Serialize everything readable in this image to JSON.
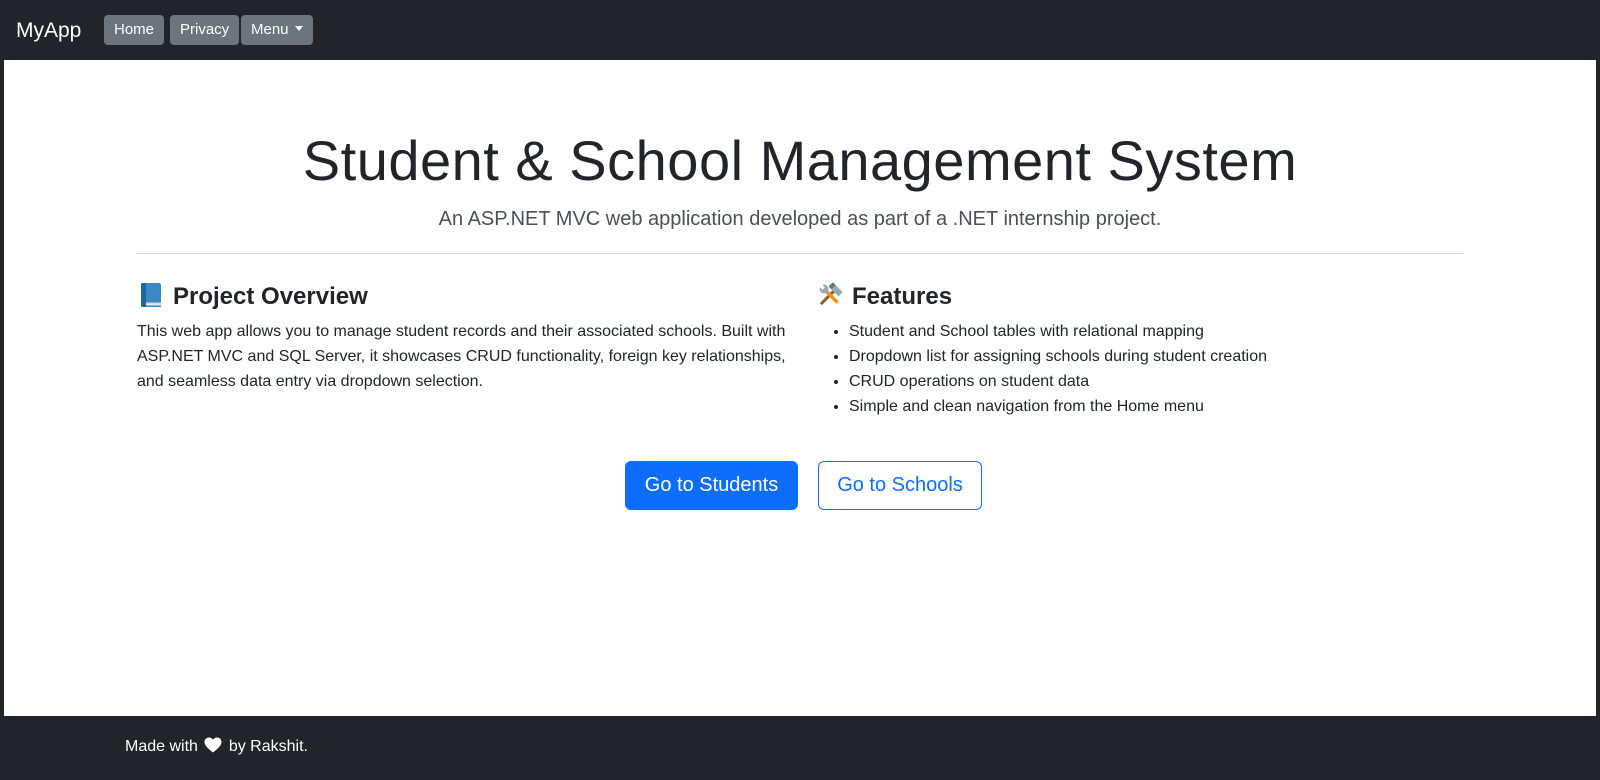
{
  "navbar": {
    "brand": "MyApp",
    "items": [
      {
        "label": "Home"
      },
      {
        "label": "Privacy"
      },
      {
        "label": "Menu"
      }
    ]
  },
  "hero": {
    "title": "Student & School Management System",
    "subtitle": "An ASP.NET MVC web application developed as part of a .NET internship project."
  },
  "overview": {
    "icon": "blue-book-icon",
    "title": "Project Overview",
    "text": "This web app allows you to manage student records and their associated schools. Built with ASP.NET MVC and SQL Server, it showcases CRUD functionality, foreign key relationships, and seamless data entry via dropdown selection."
  },
  "features": {
    "icon": "hammer-and-wrench-icon",
    "title": "Features",
    "items": [
      "Student and School tables with relational mapping",
      "Dropdown list for assigning schools during student creation",
      "CRUD operations on student data",
      "Simple and clean navigation from the Home menu"
    ]
  },
  "buttons": {
    "students": "Go to Students",
    "schools": "Go to Schools"
  },
  "footer": {
    "prefix": "Made with",
    "icon": "heart-icon",
    "suffix": "by Rakshit."
  },
  "colors": {
    "navbar_bg": "#212529",
    "nav_button_bg": "#6c757d",
    "primary": "#0d6efd",
    "text": "#212529"
  }
}
